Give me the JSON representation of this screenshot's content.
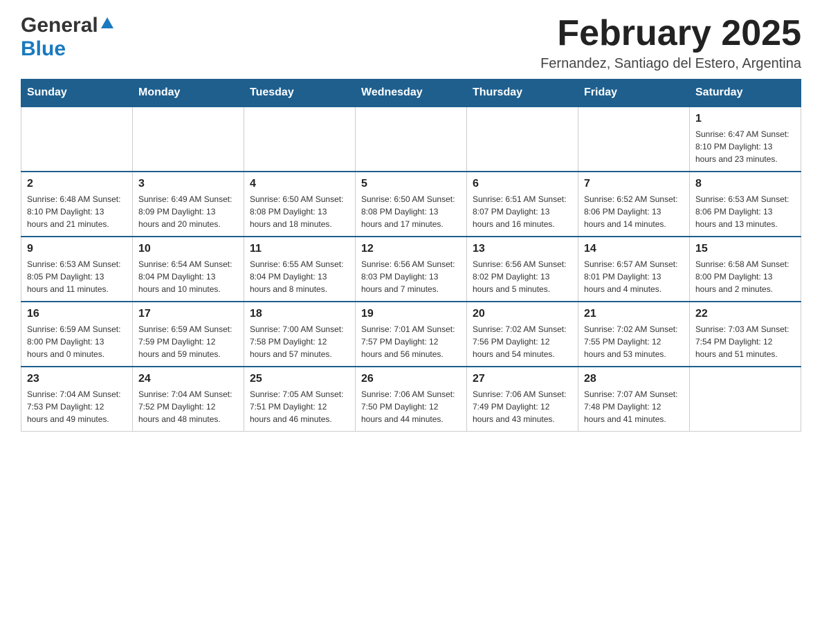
{
  "header": {
    "logo": {
      "general": "General",
      "blue": "Blue"
    },
    "title": "February 2025",
    "subtitle": "Fernandez, Santiago del Estero, Argentina"
  },
  "calendar": {
    "days_of_week": [
      "Sunday",
      "Monday",
      "Tuesday",
      "Wednesday",
      "Thursday",
      "Friday",
      "Saturday"
    ],
    "weeks": [
      {
        "days": [
          {
            "number": "",
            "info": ""
          },
          {
            "number": "",
            "info": ""
          },
          {
            "number": "",
            "info": ""
          },
          {
            "number": "",
            "info": ""
          },
          {
            "number": "",
            "info": ""
          },
          {
            "number": "",
            "info": ""
          },
          {
            "number": "1",
            "info": "Sunrise: 6:47 AM\nSunset: 8:10 PM\nDaylight: 13 hours and 23 minutes."
          }
        ]
      },
      {
        "days": [
          {
            "number": "2",
            "info": "Sunrise: 6:48 AM\nSunset: 8:10 PM\nDaylight: 13 hours and 21 minutes."
          },
          {
            "number": "3",
            "info": "Sunrise: 6:49 AM\nSunset: 8:09 PM\nDaylight: 13 hours and 20 minutes."
          },
          {
            "number": "4",
            "info": "Sunrise: 6:50 AM\nSunset: 8:08 PM\nDaylight: 13 hours and 18 minutes."
          },
          {
            "number": "5",
            "info": "Sunrise: 6:50 AM\nSunset: 8:08 PM\nDaylight: 13 hours and 17 minutes."
          },
          {
            "number": "6",
            "info": "Sunrise: 6:51 AM\nSunset: 8:07 PM\nDaylight: 13 hours and 16 minutes."
          },
          {
            "number": "7",
            "info": "Sunrise: 6:52 AM\nSunset: 8:06 PM\nDaylight: 13 hours and 14 minutes."
          },
          {
            "number": "8",
            "info": "Sunrise: 6:53 AM\nSunset: 8:06 PM\nDaylight: 13 hours and 13 minutes."
          }
        ]
      },
      {
        "days": [
          {
            "number": "9",
            "info": "Sunrise: 6:53 AM\nSunset: 8:05 PM\nDaylight: 13 hours and 11 minutes."
          },
          {
            "number": "10",
            "info": "Sunrise: 6:54 AM\nSunset: 8:04 PM\nDaylight: 13 hours and 10 minutes."
          },
          {
            "number": "11",
            "info": "Sunrise: 6:55 AM\nSunset: 8:04 PM\nDaylight: 13 hours and 8 minutes."
          },
          {
            "number": "12",
            "info": "Sunrise: 6:56 AM\nSunset: 8:03 PM\nDaylight: 13 hours and 7 minutes."
          },
          {
            "number": "13",
            "info": "Sunrise: 6:56 AM\nSunset: 8:02 PM\nDaylight: 13 hours and 5 minutes."
          },
          {
            "number": "14",
            "info": "Sunrise: 6:57 AM\nSunset: 8:01 PM\nDaylight: 13 hours and 4 minutes."
          },
          {
            "number": "15",
            "info": "Sunrise: 6:58 AM\nSunset: 8:00 PM\nDaylight: 13 hours and 2 minutes."
          }
        ]
      },
      {
        "days": [
          {
            "number": "16",
            "info": "Sunrise: 6:59 AM\nSunset: 8:00 PM\nDaylight: 13 hours and 0 minutes."
          },
          {
            "number": "17",
            "info": "Sunrise: 6:59 AM\nSunset: 7:59 PM\nDaylight: 12 hours and 59 minutes."
          },
          {
            "number": "18",
            "info": "Sunrise: 7:00 AM\nSunset: 7:58 PM\nDaylight: 12 hours and 57 minutes."
          },
          {
            "number": "19",
            "info": "Sunrise: 7:01 AM\nSunset: 7:57 PM\nDaylight: 12 hours and 56 minutes."
          },
          {
            "number": "20",
            "info": "Sunrise: 7:02 AM\nSunset: 7:56 PM\nDaylight: 12 hours and 54 minutes."
          },
          {
            "number": "21",
            "info": "Sunrise: 7:02 AM\nSunset: 7:55 PM\nDaylight: 12 hours and 53 minutes."
          },
          {
            "number": "22",
            "info": "Sunrise: 7:03 AM\nSunset: 7:54 PM\nDaylight: 12 hours and 51 minutes."
          }
        ]
      },
      {
        "days": [
          {
            "number": "23",
            "info": "Sunrise: 7:04 AM\nSunset: 7:53 PM\nDaylight: 12 hours and 49 minutes."
          },
          {
            "number": "24",
            "info": "Sunrise: 7:04 AM\nSunset: 7:52 PM\nDaylight: 12 hours and 48 minutes."
          },
          {
            "number": "25",
            "info": "Sunrise: 7:05 AM\nSunset: 7:51 PM\nDaylight: 12 hours and 46 minutes."
          },
          {
            "number": "26",
            "info": "Sunrise: 7:06 AM\nSunset: 7:50 PM\nDaylight: 12 hours and 44 minutes."
          },
          {
            "number": "27",
            "info": "Sunrise: 7:06 AM\nSunset: 7:49 PM\nDaylight: 12 hours and 43 minutes."
          },
          {
            "number": "28",
            "info": "Sunrise: 7:07 AM\nSunset: 7:48 PM\nDaylight: 12 hours and 41 minutes."
          },
          {
            "number": "",
            "info": ""
          }
        ]
      }
    ]
  }
}
